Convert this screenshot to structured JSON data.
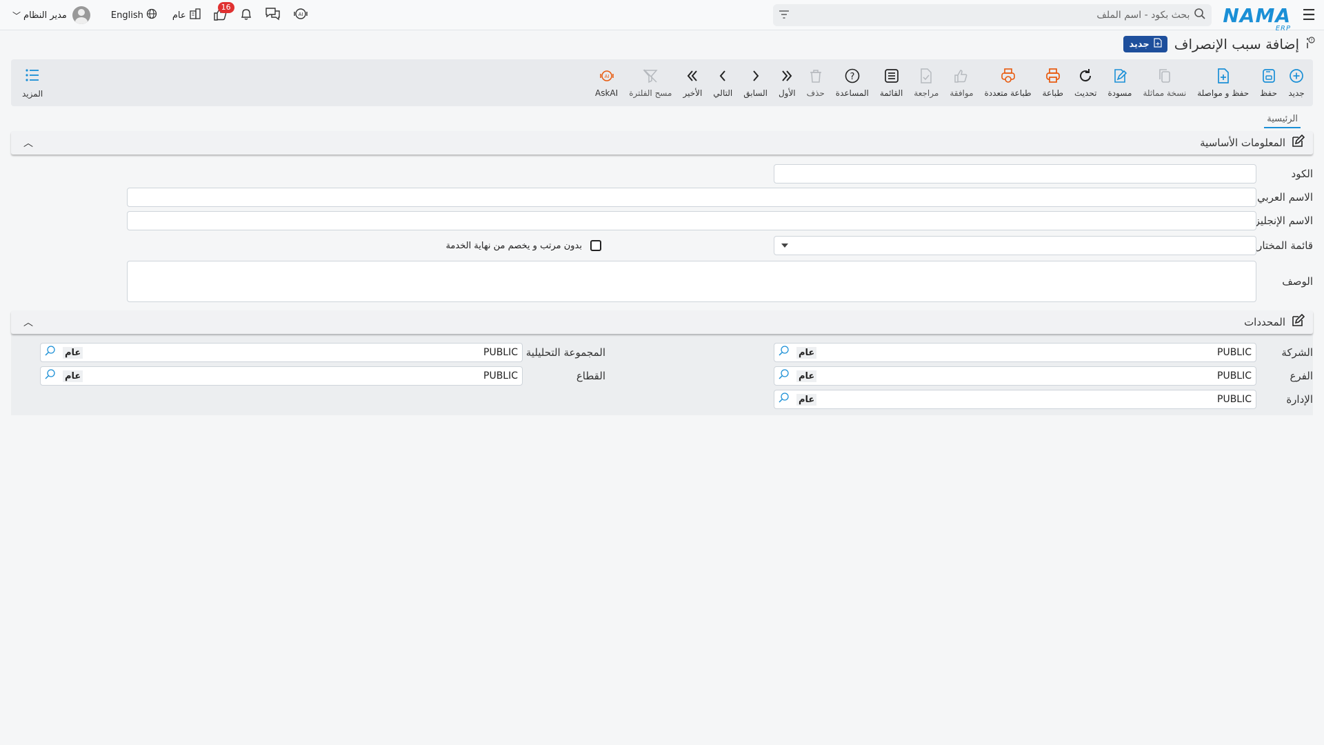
{
  "topbar": {
    "search_placeholder": "بحث بكود - اسم الملف",
    "logo_text": "NAMA",
    "logo_sub": "ERP",
    "notifications_count": "16",
    "scope_label": "عام",
    "language": "English",
    "user_name": "مدير النظام"
  },
  "header": {
    "title": "إضافة سبب الإنصراف",
    "status_badge": "جديد"
  },
  "toolbar": {
    "items": [
      {
        "label": "جديد",
        "icon": "plus-circle-icon"
      },
      {
        "label": "حفظ",
        "icon": "save-icon"
      },
      {
        "label": "حفظ و مواصلة",
        "icon": "file-plus-icon"
      },
      {
        "label": "نسخة مماثلة",
        "icon": "copy-icon"
      },
      {
        "label": "مسودة",
        "icon": "edit-draft-icon"
      },
      {
        "label": "تحديث",
        "icon": "refresh-icon"
      },
      {
        "label": "طباعة",
        "icon": "print-icon"
      },
      {
        "label": "طباعة متعددة",
        "icon": "multi-print-icon"
      },
      {
        "label": "موافقة",
        "icon": "thumbs-up-icon"
      },
      {
        "label": "مراجعة",
        "icon": "review-icon"
      },
      {
        "label": "القائمة",
        "icon": "list-icon"
      },
      {
        "label": "المساعدة",
        "icon": "help-icon"
      },
      {
        "label": "حذف",
        "icon": "trash-icon"
      },
      {
        "label": "الأول",
        "icon": "first-icon"
      },
      {
        "label": "السابق",
        "icon": "prev-icon"
      },
      {
        "label": "التالي",
        "icon": "next-icon"
      },
      {
        "label": "الأخير",
        "icon": "last-icon"
      },
      {
        "label": "مسح الفلترة",
        "icon": "clear-filter-icon"
      },
      {
        "label": "AskAI",
        "icon": "ai-icon"
      }
    ],
    "more_label": "المزيد"
  },
  "tabs": [
    {
      "label": "الرئيسية"
    }
  ],
  "basic_info": {
    "title": "المعلومات الأساسية",
    "code_label": "الكود",
    "code_value": "",
    "arabic_name_label": "الاسم العربي",
    "arabic_name_value": "",
    "english_name_label": "الاسم الإنجليزي",
    "english_name_value": "",
    "options_list_label": "قائمة المختارين",
    "options_list_value": "",
    "no_salary_label": "بدون مرتب و يخصم من نهاية الخدمة",
    "description_label": "الوصف",
    "description_value": ""
  },
  "dimensions": {
    "title": "المحددات",
    "company_label": "الشركة",
    "company_value": "PUBLIC",
    "company_name": "عام",
    "branch_label": "الفرع",
    "branch_value": "PUBLIC",
    "branch_name": "عام",
    "department_label": "الإدارة",
    "department_value": "PUBLIC",
    "department_name": "عام",
    "analysis_group_label": "المجموعة التحليلية",
    "analysis_group_value": "PUBLIC",
    "analysis_group_name": "عام",
    "sector_label": "القطاع",
    "sector_value": "PUBLIC",
    "sector_name": "عام"
  }
}
